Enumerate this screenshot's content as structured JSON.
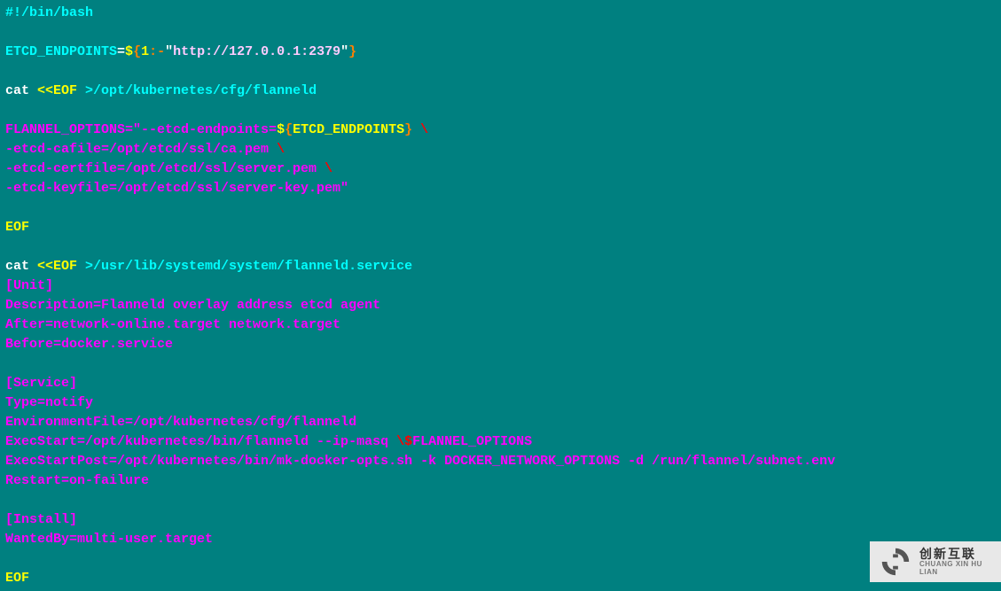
{
  "lines": [
    [
      {
        "cls": "c-cyan",
        "t": "#!/bin/bash"
      }
    ],
    [],
    [
      {
        "cls": "c-cyan",
        "t": "ETCD_ENDPOINTS"
      },
      {
        "cls": "c-white",
        "t": "="
      },
      {
        "cls": "c-yellow",
        "t": "$"
      },
      {
        "cls": "c-orange",
        "t": "{"
      },
      {
        "cls": "c-yellow",
        "t": "1"
      },
      {
        "cls": "c-orange",
        "t": ":-"
      },
      {
        "cls": "c-white",
        "t": "\""
      },
      {
        "cls": "c-pale",
        "t": "http://127.0.0.1:2379"
      },
      {
        "cls": "c-white",
        "t": "\""
      },
      {
        "cls": "c-orange",
        "t": "}"
      }
    ],
    [],
    [
      {
        "cls": "c-white",
        "t": "cat "
      },
      {
        "cls": "c-yellow",
        "t": "<<EOF "
      },
      {
        "cls": "c-cyan",
        "t": ">/opt/kubernetes/cfg/flanneld"
      }
    ],
    [],
    [
      {
        "cls": "c-magenta",
        "t": "FLANNEL_OPTIONS=\"--etcd-endpoints="
      },
      {
        "cls": "c-yellow",
        "t": "$"
      },
      {
        "cls": "c-orange",
        "t": "{"
      },
      {
        "cls": "c-yellow",
        "t": "ETCD_ENDPOINTS"
      },
      {
        "cls": "c-orange",
        "t": "}"
      },
      {
        "cls": "c-magenta",
        "t": " "
      },
      {
        "cls": "c-red",
        "t": "\\"
      }
    ],
    [
      {
        "cls": "c-magenta",
        "t": "-etcd-cafile=/opt/etcd/ssl/ca.pem "
      },
      {
        "cls": "c-red",
        "t": "\\"
      }
    ],
    [
      {
        "cls": "c-magenta",
        "t": "-etcd-certfile=/opt/etcd/ssl/server.pem "
      },
      {
        "cls": "c-red",
        "t": "\\"
      }
    ],
    [
      {
        "cls": "c-magenta",
        "t": "-etcd-keyfile=/opt/etcd/ssl/server-key.pem\""
      }
    ],
    [],
    [
      {
        "cls": "c-yellow",
        "t": "EOF"
      }
    ],
    [],
    [
      {
        "cls": "c-white",
        "t": "cat "
      },
      {
        "cls": "c-yellow",
        "t": "<<EOF "
      },
      {
        "cls": "c-cyan",
        "t": ">/usr/lib/systemd/system/flanneld.service"
      }
    ],
    [
      {
        "cls": "c-magenta",
        "t": "[Unit]"
      }
    ],
    [
      {
        "cls": "c-magenta",
        "t": "Description=Flanneld overlay address etcd agent"
      }
    ],
    [
      {
        "cls": "c-magenta",
        "t": "After=network-online.target network.target"
      }
    ],
    [
      {
        "cls": "c-magenta",
        "t": "Before=docker.service"
      }
    ],
    [],
    [
      {
        "cls": "c-magenta",
        "t": "[Service]"
      }
    ],
    [
      {
        "cls": "c-magenta",
        "t": "Type=notify"
      }
    ],
    [
      {
        "cls": "c-magenta",
        "t": "EnvironmentFile=/opt/kubernetes/cfg/flanneld"
      }
    ],
    [
      {
        "cls": "c-magenta",
        "t": "ExecStart=/opt/kubernetes/bin/flanneld --ip-masq "
      },
      {
        "cls": "c-red",
        "t": "\\$"
      },
      {
        "cls": "c-magenta",
        "t": "FLANNEL_OPTIONS"
      }
    ],
    [
      {
        "cls": "c-magenta",
        "t": "ExecStartPost=/opt/kubernetes/bin/mk-docker-opts.sh -k DOCKER_NETWORK_OPTIONS -d /run/flannel/subnet.env"
      }
    ],
    [
      {
        "cls": "c-magenta",
        "t": "Restart=on-failure"
      }
    ],
    [],
    [
      {
        "cls": "c-magenta",
        "t": "[Install]"
      }
    ],
    [
      {
        "cls": "c-magenta",
        "t": "WantedBy=multi-user.target"
      }
    ],
    [],
    [
      {
        "cls": "c-yellow",
        "t": "EOF"
      }
    ]
  ],
  "watermark": {
    "cn": "创新互联",
    "en": "CHUANG XIN HU LIAN"
  }
}
